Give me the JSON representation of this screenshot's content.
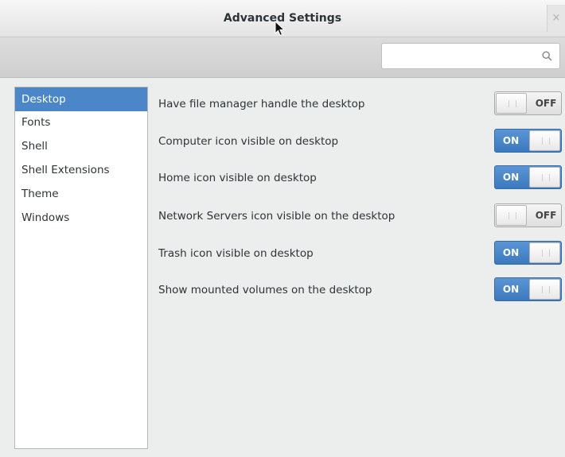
{
  "window": {
    "title": "Advanced Settings",
    "close_glyph": "×"
  },
  "search": {
    "value": "",
    "placeholder": "",
    "icon": "search-icon"
  },
  "sidebar": {
    "items": [
      {
        "label": "Desktop",
        "selected": true
      },
      {
        "label": "Fonts",
        "selected": false
      },
      {
        "label": "Shell",
        "selected": false
      },
      {
        "label": "Shell Extensions",
        "selected": false
      },
      {
        "label": "Theme",
        "selected": false
      },
      {
        "label": "Windows",
        "selected": false
      }
    ]
  },
  "settings": [
    {
      "label": "Have file manager handle the desktop",
      "state": "OFF"
    },
    {
      "label": "Computer icon visible on desktop",
      "state": "ON"
    },
    {
      "label": "Home icon visible on desktop",
      "state": "ON"
    },
    {
      "label": "Network Servers icon visible on the desktop",
      "state": "OFF"
    },
    {
      "label": "Trash icon visible on desktop",
      "state": "ON"
    },
    {
      "label": "Show mounted volumes on the desktop",
      "state": "ON"
    }
  ],
  "colors": {
    "accent": "#4a86c8",
    "switch_on": "#3b78be",
    "text": "#2e3436"
  }
}
